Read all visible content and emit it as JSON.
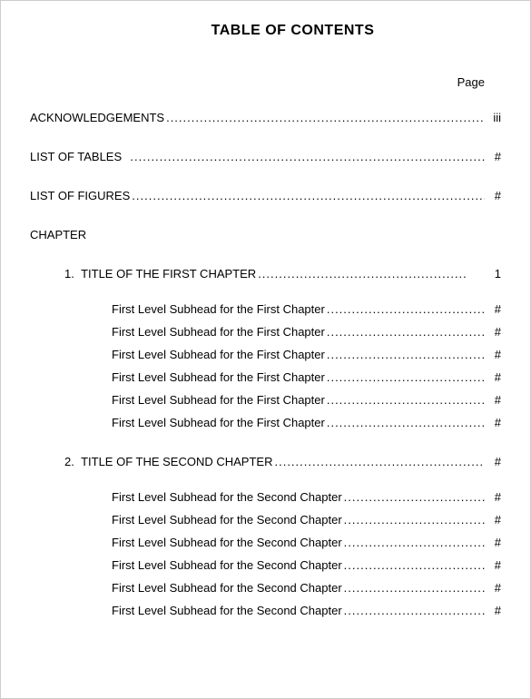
{
  "title": "TABLE OF CONTENTS",
  "page_label": "Page",
  "front": {
    "ack": {
      "label": "ACKNOWLEDGEMENTS",
      "page": "iii"
    },
    "lot": {
      "label": "LIST OF TABLES",
      "page": "#"
    },
    "lof": {
      "label": "LIST OF FIGURES",
      "page": "#"
    }
  },
  "chapter_head": "CHAPTER",
  "chapters": [
    {
      "num": "1.",
      "title": "TITLE OF THE FIRST CHAPTER",
      "page": "1",
      "subs": [
        {
          "label": "First Level Subhead for the First Chapter",
          "page": "#"
        },
        {
          "label": "First Level Subhead for the First Chapter",
          "page": "#"
        },
        {
          "label": "First Level Subhead for the First Chapter",
          "page": "#"
        },
        {
          "label": "First Level Subhead for the First Chapter",
          "page": "#"
        },
        {
          "label": "First Level Subhead for the First Chapter",
          "page": "#"
        },
        {
          "label": "First Level Subhead for the First Chapter",
          "page": "#"
        }
      ]
    },
    {
      "num": "2.",
      "title": "TITLE OF THE SECOND CHAPTER",
      "page": "#",
      "subs": [
        {
          "label": "First Level Subhead for the Second Chapter",
          "page": "#"
        },
        {
          "label": "First Level Subhead for the Second Chapter",
          "page": "#"
        },
        {
          "label": "First Level Subhead for the Second Chapter",
          "page": "#"
        },
        {
          "label": "First Level Subhead for the Second Chapter",
          "page": "#"
        },
        {
          "label": "First Level Subhead for the Second Chapter",
          "page": "#"
        },
        {
          "label": "First Level Subhead for the Second Chapter",
          "page": "#"
        }
      ]
    }
  ]
}
